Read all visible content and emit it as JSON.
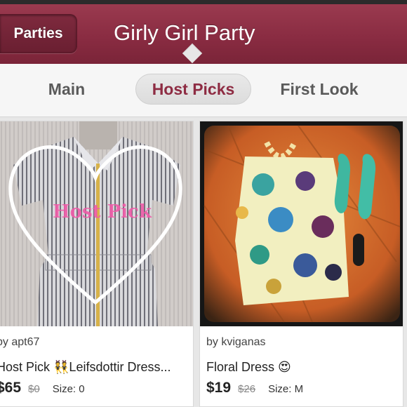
{
  "header": {
    "back_label": "Parties",
    "title": "Girly Girl Party"
  },
  "tabs": [
    {
      "label": "Main",
      "active": false
    },
    {
      "label": "Host Picks",
      "active": true
    },
    {
      "label": "First Look",
      "active": false
    }
  ],
  "colors": {
    "brand": "#8a2c42",
    "active_tab_text": "#8e2c43"
  },
  "listings": [
    {
      "seller": "by apt67",
      "name": "Host Pick 👯Leifsdottir Dress...",
      "price": "$65",
      "original_price": "$0",
      "size": "Size: 0",
      "badge_text": "Host Pick"
    },
    {
      "seller": "by kviganas",
      "name": "Floral Dress 😍",
      "price": "$19",
      "original_price": "$26",
      "size": "Size: M"
    }
  ]
}
